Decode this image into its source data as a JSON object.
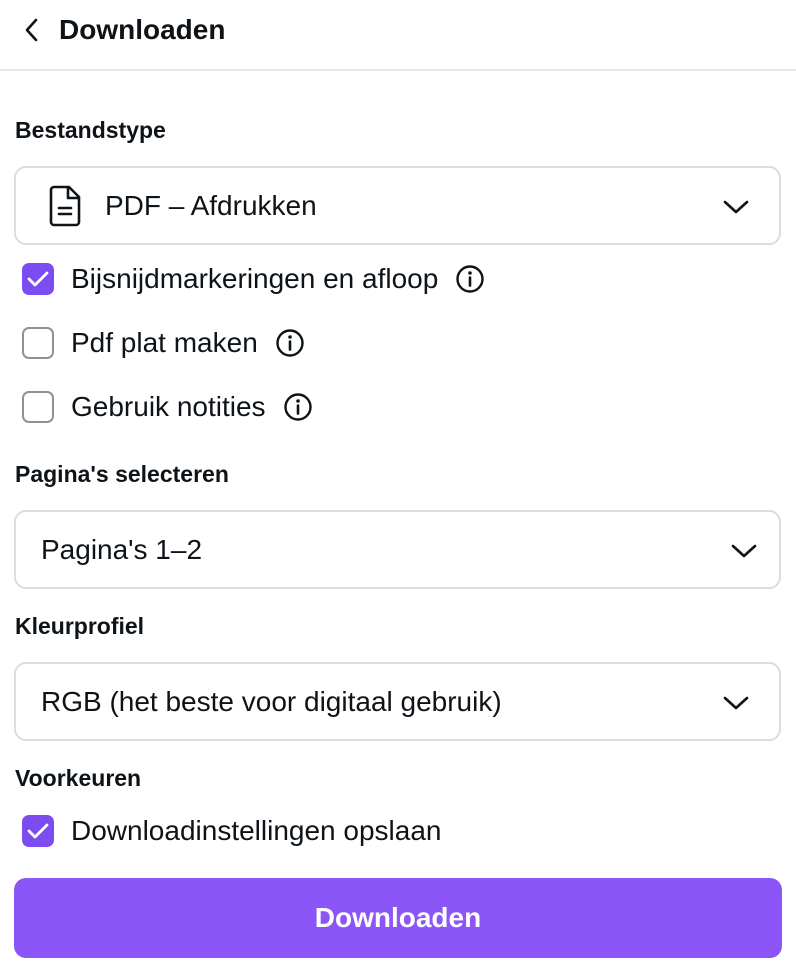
{
  "header": {
    "title": "Downloaden",
    "back_icon": "chevron-left-icon"
  },
  "file_type": {
    "label": "Bestandstype",
    "value": "PDF – Afdrukken",
    "icon": "document-icon"
  },
  "options": [
    {
      "label": "Bijsnijdmarkeringen en afloop",
      "checked": true,
      "has_info": true
    },
    {
      "label": "Pdf plat maken",
      "checked": false,
      "has_info": true
    },
    {
      "label": "Gebruik notities",
      "checked": false,
      "has_info": true
    }
  ],
  "pages": {
    "label": "Pagina's selecteren",
    "value": "Pagina's 1–2"
  },
  "color_profile": {
    "label": "Kleurprofiel",
    "value": "RGB (het beste voor digitaal gebruik)"
  },
  "preferences": {
    "label": "Voorkeuren",
    "save_settings_label": "Downloadinstellingen opslaan",
    "save_settings_checked": true
  },
  "download_button": {
    "label": "Downloaden"
  },
  "colors": {
    "accent": "#7d4cf0",
    "button": "#8b55f7",
    "text": "#0e1318",
    "border": "#dadce0"
  }
}
